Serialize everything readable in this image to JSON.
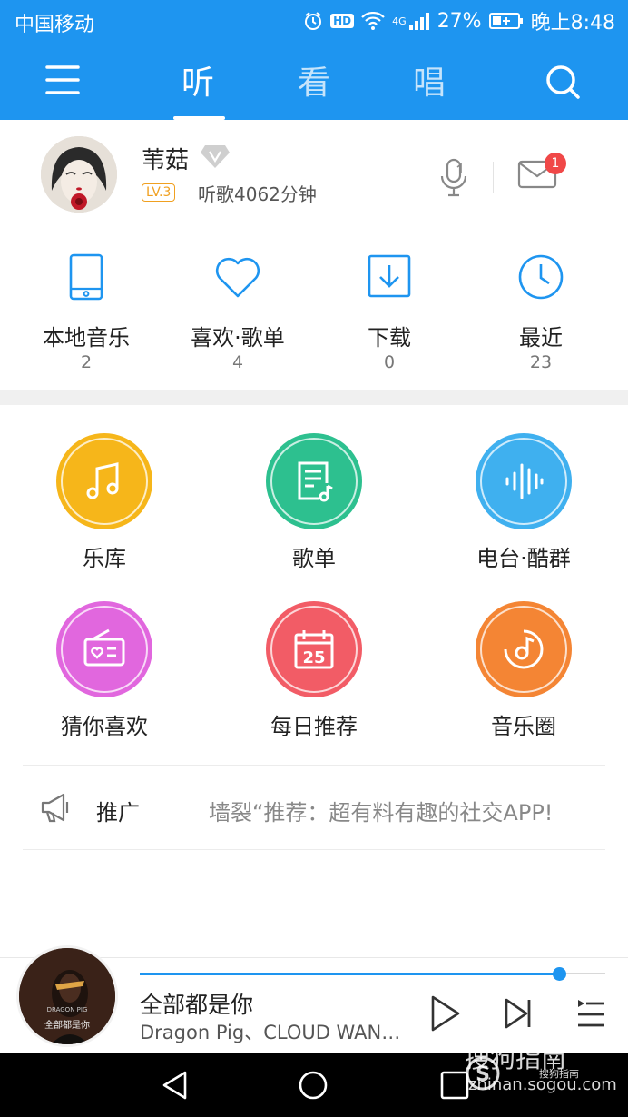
{
  "status_bar": {
    "carrier": "中国移动",
    "hd": "HD",
    "network": "4G",
    "battery": "27%",
    "time": "晚上8:48"
  },
  "nav": {
    "tabs": [
      {
        "label": "听",
        "active": true
      },
      {
        "label": "看",
        "active": false
      },
      {
        "label": "唱",
        "active": false
      }
    ]
  },
  "profile": {
    "username": "苇菇",
    "level": "LV.3",
    "listen_time": "听歌4062分钟",
    "mail_badge": "1"
  },
  "quick_stats": [
    {
      "label": "本地音乐",
      "count": "2",
      "icon": "phone-icon"
    },
    {
      "label": "喜欢·歌单",
      "count": "4",
      "icon": "heart-icon"
    },
    {
      "label": "下载",
      "count": "0",
      "icon": "download-icon"
    },
    {
      "label": "最近",
      "count": "23",
      "icon": "clock-icon"
    }
  ],
  "grid": [
    {
      "label": "乐库",
      "color": "#f6b61a",
      "icon": "music-note-icon"
    },
    {
      "label": "歌单",
      "color": "#2dc08f",
      "icon": "playlist-icon"
    },
    {
      "label": "电台·酷群",
      "color": "#3fb0ef",
      "icon": "soundwave-icon"
    },
    {
      "label": "猜你喜欢",
      "color": "#e167de",
      "icon": "radio-icon"
    },
    {
      "label": "每日推荐",
      "color": "#f25c66",
      "icon": "calendar-icon",
      "day": "25"
    },
    {
      "label": "音乐圈",
      "color": "#f48534",
      "icon": "music-circle-icon"
    }
  ],
  "promo": {
    "title": "推广",
    "text": "墙裂“推荐：超有料有趣的社交APP!"
  },
  "player": {
    "song": "全部都是你",
    "artist": "Dragon Pig、CLOUD WANG…",
    "cover_text": "全部都是你",
    "cover_subtext": "DRAGON PIG",
    "progress": 0.9
  },
  "watermark": {
    "brand": "搜狗指南",
    "url": "zhinan.sogou.com",
    "small": "搜狗指南"
  },
  "colors": {
    "primary": "#1e95f0",
    "badge": "#f04848",
    "level": "#f0a020"
  }
}
